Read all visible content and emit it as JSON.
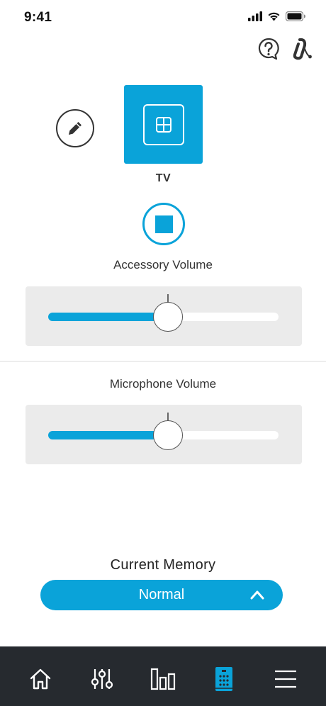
{
  "status_bar": {
    "time": "9:41",
    "icons": [
      "cellular-signal-icon",
      "wifi-icon",
      "battery-icon"
    ]
  },
  "header": {
    "actions": [
      "help-icon",
      "hearing-aid-icon"
    ]
  },
  "program": {
    "name": "TV",
    "icon": "tv-streamer-icon",
    "edit_icon": "pencil-icon",
    "stop_icon": "stop-icon"
  },
  "accessory_volume": {
    "label": "Accessory Volume",
    "level_percent": 52
  },
  "microphone_volume": {
    "label": "Microphone Volume",
    "level_percent": 52
  },
  "memory": {
    "title": "Current Memory",
    "selected": "Normal",
    "chevron": "chevron-up-icon"
  },
  "tabbar": {
    "items": [
      "home-icon",
      "adjust-sliders-icon",
      "statistics-icon",
      "remote-icon",
      "menu-icon"
    ],
    "active": "remote-icon"
  },
  "colors": {
    "accent": "#0aa3d9",
    "tabbar_bg": "#262a2f",
    "panel_bg": "#ebebeb"
  }
}
